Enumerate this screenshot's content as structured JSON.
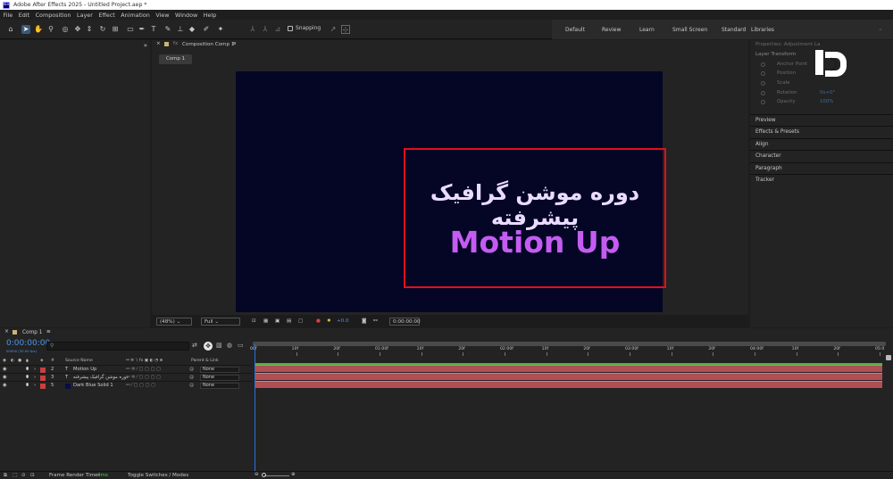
{
  "title": "Adobe After Effects 2025 - Untitled Project.aep *",
  "app_logo": "Ae",
  "menu": [
    "File",
    "Edit",
    "Composition",
    "Layer",
    "Effect",
    "Animation",
    "View",
    "Window",
    "Help"
  ],
  "toolbar": {
    "snapping_label": "Snapping",
    "workspaces": [
      "Default",
      "Review",
      "Learn",
      "Small Screen",
      "Standard",
      "Libraries"
    ]
  },
  "composition_panel": {
    "tab_label": "Composition Comp 1",
    "comp_chip": "Comp 1",
    "canvas": {
      "persian_title": "دوره موشن گرافیک پیشرفته",
      "main_text": "Motion Up",
      "background_color": "#050526",
      "frame_color": "#e0101a",
      "text_color": "#c55cf2"
    },
    "viewer": {
      "zoom": "(48%)",
      "resolution": "Full",
      "exposure": "+0.0",
      "timecode": "0:00:00:00"
    }
  },
  "properties_panel": {
    "title": "Properties: Adjustment La",
    "section": "Layer Transform",
    "rows": [
      {
        "label": "Anchor Point",
        "value": ""
      },
      {
        "label": "Position",
        "value": ""
      },
      {
        "label": "Scale",
        "value": ""
      },
      {
        "label": "Rotation",
        "value": "0x+0°"
      },
      {
        "label": "Opacity",
        "value": "100%"
      }
    ],
    "panels": [
      "Preview",
      "Effects & Presets",
      "Align",
      "Character",
      "Paragraph",
      "Tracker"
    ]
  },
  "timeline": {
    "tab_label": "Comp 1",
    "timecode": "0:00:00:00",
    "fps_label": "00000 (30.00 fps)",
    "columns": {
      "number": "#",
      "source_name": "Source Name",
      "parent": "Parent & Link"
    },
    "layers": [
      {
        "number": "2",
        "type": "T",
        "name": "Motion Up",
        "parent": "None"
      },
      {
        "number": "3",
        "type": "T",
        "name": "دوره موشن گرافیک پیشرفته",
        "parent": "None"
      },
      {
        "number": "5",
        "type": "",
        "name": "Dark Blue Solid 1",
        "parent": "None"
      }
    ],
    "ruler_labels": [
      "00f",
      "10f",
      "20f",
      "01:00f",
      "10f",
      "20f",
      "02:00f",
      "10f",
      "20f",
      "03:00f",
      "10f",
      "20f",
      "04:00f",
      "10f",
      "20f",
      "05:0"
    ],
    "layer_bar_color": "#b04f55"
  },
  "statusbar": {
    "render_label": "Frame Render Time:",
    "render_value": "4ms",
    "toggle_label": "Toggle Switches / Modes"
  }
}
